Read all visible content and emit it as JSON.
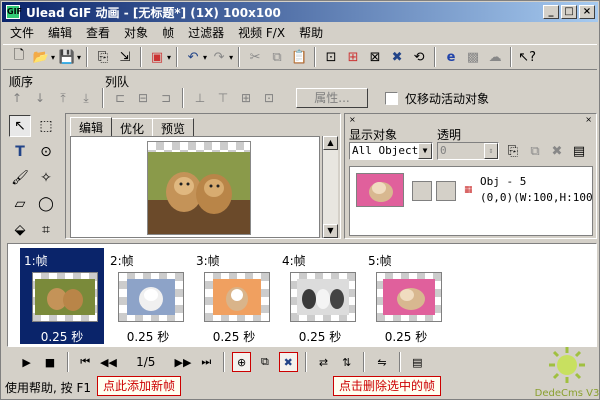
{
  "window": {
    "title": "Ulead GIF 动画 - [无标题*] (1X) 100x100",
    "icon_label": "GIF"
  },
  "menu": [
    "文件",
    "编辑",
    "查看",
    "对象",
    "帧",
    "过滤器",
    "视频 F/X",
    "帮助"
  ],
  "labels": {
    "sequence": "顺序",
    "queue": "列队"
  },
  "objbar": {
    "properties_label": "属性...",
    "only_move_active": "仅移动活动对象"
  },
  "tabs": [
    "编辑",
    "优化",
    "预览"
  ],
  "object_panel": {
    "show_object_label": "显示对象",
    "transparency_label": "透明",
    "show_object_value": "All Objects",
    "transparency_value": "0",
    "obj_name": "Obj - 5",
    "obj_geom": "(0,0)(W:100,H:100)"
  },
  "frames": [
    {
      "label": "1:帧",
      "delay": "0.25 秒",
      "selected": true
    },
    {
      "label": "2:帧",
      "delay": "0.25 秒",
      "selected": false
    },
    {
      "label": "3:帧",
      "delay": "0.25 秒",
      "selected": false
    },
    {
      "label": "4:帧",
      "delay": "0.25 秒",
      "selected": false
    },
    {
      "label": "5:帧",
      "delay": "0.25 秒",
      "selected": false
    }
  ],
  "anim": {
    "frame_counter": "1/5"
  },
  "status": {
    "text": "使用帮助, 按 F1"
  },
  "callouts": {
    "add_frame": "点此添加新帧",
    "delete_frame": "点击删除选中的帧"
  },
  "watermark": {
    "text": "DedeCms V3"
  },
  "colors": {
    "title_start": "#0a246a",
    "title_end": "#a6caf0",
    "selection": "#0a246a",
    "callout": "#cc0000",
    "face": "#d4d0c8"
  },
  "icons": {
    "toolbar": [
      "new-file-icon",
      "open-folder-icon",
      "save-icon",
      "import-icon",
      "export-icon",
      "optimize-icon",
      "undo-icon",
      "redo-icon",
      "cut-icon",
      "copy-icon",
      "paste-icon",
      "crop-icon",
      "resize-icon",
      "wizard-icon",
      "delete-icon",
      "ie-preview-icon",
      "optimize-wizard-icon",
      "help-arrow-icon"
    ],
    "tools": [
      "pick-tool-icon",
      "marquee-tool-icon",
      "text-tool-icon",
      "lasso-tool-icon",
      "paintbrush-tool-icon",
      "magic-wand-tool-icon",
      "eraser-tool-icon",
      "ellipse-tool-icon",
      "fill-tool-icon",
      "transform-tool-icon"
    ],
    "anim": [
      "play-icon",
      "stop-icon",
      "first-frame-icon",
      "prev-frame-icon",
      "next-frame-icon",
      "last-frame-icon",
      "add-frame-icon",
      "duplicate-frame-icon",
      "delete-frame-icon",
      "tween-icon",
      "reverse-icon",
      "frame-props-icon",
      "insert-file-icon"
    ]
  }
}
